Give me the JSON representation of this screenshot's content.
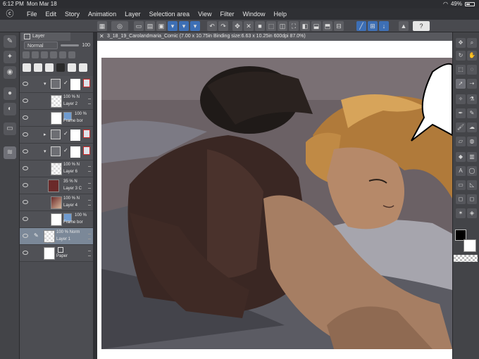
{
  "status_bar": {
    "time": "6:12 PM",
    "date": "Mon Mar 18",
    "battery": "49%"
  },
  "menu": {
    "items": [
      "File",
      "Edit",
      "Story",
      "Animation",
      "Layer",
      "Selection area",
      "View",
      "Filter",
      "Window",
      "Help"
    ]
  },
  "layer_panel": {
    "tab_label": "Layer",
    "blend_mode": "Normal",
    "opacity": "100",
    "layers": [
      {
        "pct": "100 % N",
        "name": "Layer 2"
      },
      {
        "pct": "100 %",
        "name": "Frame bor"
      },
      {
        "pct": "100 % N",
        "name": "Layer 6"
      },
      {
        "pct": "35 % N",
        "name": "Layer 3 C"
      },
      {
        "pct": "100 % N",
        "name": "Layer 4"
      },
      {
        "pct": "100 %",
        "name": "Frame bor"
      },
      {
        "pct": "100 % Norm",
        "name": "Layer 1"
      },
      {
        "pct": "",
        "name": "Paper"
      }
    ]
  },
  "canvas": {
    "title": "3_18_19_Carolandmaria_Comic (7.00 x 10.75in Binding size:6.63 x 10.25in 600dpi 87.0%)"
  },
  "colors": {
    "accent": "#3d6fb5",
    "selected_layer": "#7b8898",
    "panel_bg": "#4c4d52"
  },
  "icons": [
    "brush-tool-icon",
    "eyedropper-icon",
    "pen-icon",
    "eraser-icon",
    "fill-icon",
    "text-icon",
    "hand-icon",
    "zoom-icon"
  ]
}
